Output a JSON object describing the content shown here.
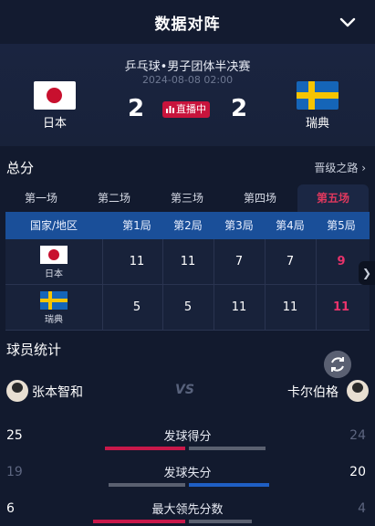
{
  "header": {
    "title": "数据对阵"
  },
  "match": {
    "event": "乒乓球•男子团体半决赛",
    "time": "2024-08-08 02:00",
    "home": {
      "name": "日本",
      "score": "2"
    },
    "away": {
      "name": "瑞典",
      "score": "2"
    },
    "status": "直播中"
  },
  "summary": {
    "title": "总分",
    "link": "晋级之路"
  },
  "tabs": [
    "第一场",
    "第二场",
    "第三场",
    "第四场",
    "第五场"
  ],
  "table": {
    "headers": [
      "国家/地区",
      "第1局",
      "第2局",
      "第3局",
      "第4局",
      "第5局"
    ],
    "rows": [
      {
        "country": "日本",
        "scores": [
          "11",
          "11",
          "7",
          "7",
          "9"
        ]
      },
      {
        "country": "瑞典",
        "scores": [
          "5",
          "5",
          "11",
          "11",
          "11"
        ]
      }
    ]
  },
  "players": {
    "title": "球员统计",
    "left_name": "张本智和",
    "right_name": "卡尔伯格",
    "vs": "VS"
  },
  "stats": [
    {
      "label": "发球得分",
      "left": "25",
      "right": "24",
      "left_fraction": 0.51,
      "right_fraction": 0.49
    },
    {
      "label": "发球失分",
      "left": "19",
      "right": "20",
      "left_fraction": 0.49,
      "right_fraction": 0.51
    },
    {
      "label": "最大领先分数",
      "left": "6",
      "right": "4",
      "left_fraction": 0.6,
      "right_fraction": 0.4
    }
  ],
  "colors": {
    "accent_pink": "#e0385e",
    "header_blue": "#1a4f99",
    "bar_pink": "#c8184a",
    "bar_blue": "#1f5fc4",
    "bar_grey": "#5a6070"
  }
}
